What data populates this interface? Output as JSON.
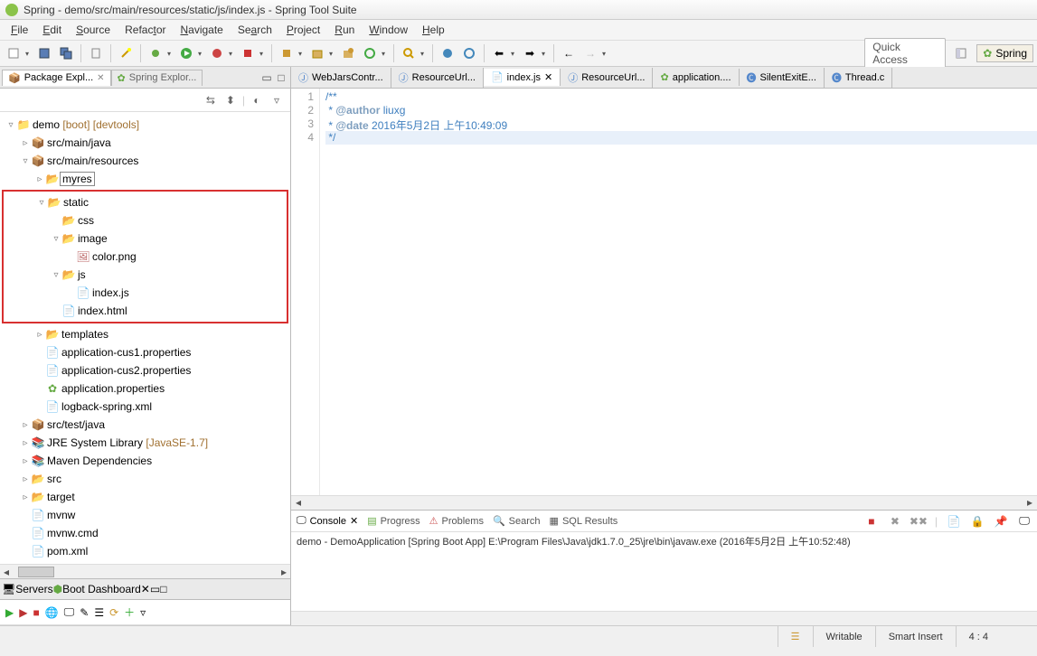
{
  "window": {
    "title": "Spring - demo/src/main/resources/static/js/index.js - Spring Tool Suite"
  },
  "menu": [
    "File",
    "Edit",
    "Source",
    "Refactor",
    "Navigate",
    "Search",
    "Project",
    "Run",
    "Window",
    "Help"
  ],
  "quick_access": "Quick Access",
  "perspective": "Spring",
  "left_views": {
    "active": "Package Expl...",
    "inactive": "Spring Explor..."
  },
  "tree": {
    "root": {
      "label": "demo",
      "decor": "[boot] [devtools]"
    },
    "src_main_java": "src/main/java",
    "src_main_resources": "src/main/resources",
    "myres": "myres",
    "static": "static",
    "css": "css",
    "image": "image",
    "color_png": "color.png",
    "js": "js",
    "index_js": "index.js",
    "index_html": "index.html",
    "templates": "templates",
    "app_cus1": "application-cus1.properties",
    "app_cus2": "application-cus2.properties",
    "app_props": "application.properties",
    "logback": "logback-spring.xml",
    "src_test_java": "src/test/java",
    "jre": {
      "label": "JRE System Library",
      "decor": "[JavaSE-1.7]"
    },
    "maven": "Maven Dependencies",
    "src": "src",
    "target": "target",
    "mvnw": "mvnw",
    "mvnw_cmd": "mvnw.cmd",
    "pom": "pom.xml"
  },
  "bottom_views": {
    "servers": "Servers",
    "boot_dashboard": "Boot Dashboard"
  },
  "editor_tabs": [
    {
      "icon": "java-icon",
      "label": "WebJarsContr..."
    },
    {
      "icon": "java-icon",
      "label": "ResourceUrl..."
    },
    {
      "icon": "js-icon",
      "label": "index.js",
      "active": true,
      "closable": true
    },
    {
      "icon": "java-icon",
      "label": "ResourceUrl..."
    },
    {
      "icon": "leaf-icon",
      "label": "application...."
    },
    {
      "icon": "class-icon",
      "label": "SilentExitE..."
    },
    {
      "icon": "class-icon",
      "label": "Thread.c"
    }
  ],
  "code": {
    "l1": "/**",
    "l2_a": " * ",
    "l2_b": "@author",
    "l2_c": " liuxg",
    "l3_a": " * ",
    "l3_b": "@date",
    "l3_c": " 2016年5月2日 上午10:49:09",
    "l4": " */"
  },
  "console_tabs": [
    "Console",
    "Progress",
    "Problems",
    "Search",
    "SQL Results"
  ],
  "console_text": "demo - DemoApplication [Spring Boot App] E:\\Program Files\\Java\\jdk1.7.0_25\\jre\\bin\\javaw.exe (2016年5月2日 上午10:52:48)",
  "status": {
    "writable": "Writable",
    "insert": "Smart Insert",
    "pos": "4 : 4"
  }
}
